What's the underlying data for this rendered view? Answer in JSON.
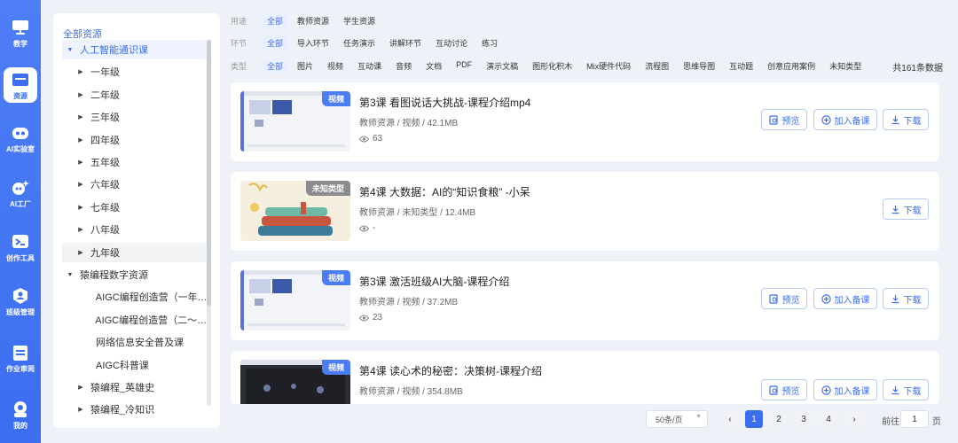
{
  "rail": [
    {
      "label": "教学",
      "icon": "monitor-icon"
    },
    {
      "label": "资源",
      "icon": "folder-icon"
    },
    {
      "label": "AI实验室",
      "icon": "robot-icon"
    },
    {
      "label": "AI工厂",
      "icon": "sparkle-icon"
    },
    {
      "label": "创作工具",
      "icon": "terminal-icon"
    },
    {
      "label": "班级管理",
      "icon": "class-icon"
    },
    {
      "label": "作业审阅",
      "icon": "homework-icon"
    },
    {
      "label": "我的",
      "icon": "user-icon"
    }
  ],
  "tree": {
    "root": "全部资源",
    "items": [
      {
        "label": "人工智能通识课",
        "caret": "▼",
        "state": "selected"
      },
      {
        "label": "一年级",
        "caret": "▶"
      },
      {
        "label": "二年级",
        "caret": "▶"
      },
      {
        "label": "三年级",
        "caret": "▶"
      },
      {
        "label": "四年级",
        "caret": "▶"
      },
      {
        "label": "五年级",
        "caret": "▶"
      },
      {
        "label": "六年级",
        "caret": "▶"
      },
      {
        "label": "七年级",
        "caret": "▶"
      },
      {
        "label": "八年级",
        "caret": "▶"
      },
      {
        "label": "九年级",
        "caret": "▶",
        "state": "hover"
      },
      {
        "label": "猿编程数字资源",
        "caret": "▼"
      },
      {
        "label": "AIGC编程创造营（一年级）",
        "caret": ""
      },
      {
        "label": "AIGC编程创造营（二～六年级）",
        "caret": ""
      },
      {
        "label": "网络信息安全普及课",
        "caret": ""
      },
      {
        "label": "AIGC科普课",
        "caret": ""
      },
      {
        "label": "猿编程_英雄史",
        "caret": "▶"
      },
      {
        "label": "猿编程_冷知识",
        "caret": "▶"
      }
    ]
  },
  "filters": {
    "usage": {
      "label": "用途",
      "options": [
        "全部",
        "教师资源",
        "学生资源"
      ],
      "selected": 0
    },
    "stage": {
      "label": "环节",
      "options": [
        "全部",
        "导入环节",
        "任务演示",
        "讲解环节",
        "互动讨论",
        "练习"
      ],
      "selected": 0
    },
    "type": {
      "label": "类型",
      "options": [
        "全部",
        "图片",
        "视频",
        "互动课",
        "音频",
        "文档",
        "PDF",
        "演示文稿",
        "图形化积木",
        "Mix硬件代码",
        "流程图",
        "思维导图",
        "互动题",
        "创意应用案例",
        "未知类型"
      ],
      "selected": 0
    },
    "total": "共161条数据"
  },
  "cards": [
    {
      "title": "第3课 看图说话大挑战-课程介绍mp4",
      "meta": "教师资源 / 视频 / 42.1MB",
      "views": "63",
      "tag": "视频",
      "thumb": "screen"
    },
    {
      "title": "第4课 大数据：AI的“知识食粮” -小呆",
      "meta": "教师资源 / 未知类型 / 12.4MB",
      "views": "-",
      "tag": "未知类型",
      "thumb": "books"
    },
    {
      "title": "第3课 激活班级AI大脑-课程介绍",
      "meta": "教师资源 / 视频 / 37.2MB",
      "views": "23",
      "tag": "视频",
      "thumb": "screen"
    },
    {
      "title": "第4课 读心术的秘密：决策树-课程介绍",
      "meta": "教师资源 / 视频 / 354.8MB",
      "views": "",
      "tag": "视频",
      "thumb": "dark"
    }
  ],
  "actions": {
    "preview": "预览",
    "add": "加入备课",
    "download": "下载"
  },
  "pagination": {
    "page_size": "50条/页",
    "pages": [
      "1",
      "2",
      "3",
      "4"
    ],
    "current": "1",
    "prev": "‹",
    "next": "›",
    "goto_prefix": "前往",
    "goto_value": "1",
    "goto_suffix": "页"
  },
  "colors": {
    "accent": "#3b6ef0",
    "rail": "#4e7ef6",
    "background": "#eef2f8"
  }
}
